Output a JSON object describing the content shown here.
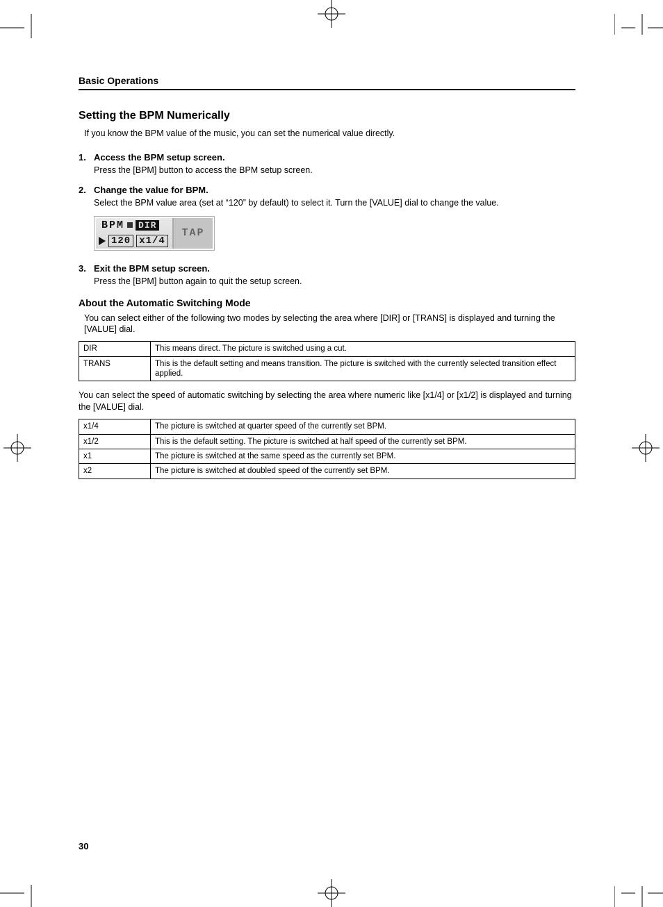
{
  "running_head": "Basic Operations",
  "section_title": "Setting the BPM Numerically",
  "intro": "If you know the BPM value of the music, you can set the numerical value directly.",
  "steps": [
    {
      "title": "Access the BPM setup screen.",
      "body": "Press the [BPM] button to access the BPM setup screen."
    },
    {
      "title": "Change the value for BPM.",
      "body": "Select the BPM value area (set at “120” by default) to select it. Turn the [VALUE] dial to change the value."
    },
    {
      "title": "Exit the BPM setup screen.",
      "body": "Press the [BPM] button again to quit the setup screen."
    }
  ],
  "lcd": {
    "bpm_label": "BPM",
    "mode": "DIR",
    "value": "120",
    "rate": "x1/4",
    "tap": "TAP"
  },
  "subsection_title": "About the Automatic Switching Mode",
  "mode_intro": "You can select either of the following two modes by selecting the area where [DIR] or [TRANS] is displayed and turning the [VALUE] dial.",
  "mode_table": [
    {
      "key": "DIR",
      "desc": "This means direct. The picture is switched using a cut."
    },
    {
      "key": "TRANS",
      "desc": "This is the default setting and means transition. The picture is switched with the currently selected transition effect applied."
    }
  ],
  "speed_intro": "You can select the speed of automatic switching by selecting the area where numeric like [x1/4] or [x1/2] is displayed and turning the [VALUE] dial.",
  "speed_table": [
    {
      "key": "x1/4",
      "desc": "The picture is switched at quarter speed of the currently set BPM."
    },
    {
      "key": "x1/2",
      "desc": "This is the default setting. The picture is switched at half speed of the currently set BPM."
    },
    {
      "key": "x1",
      "desc": "The picture is switched at the same speed as the currently set BPM."
    },
    {
      "key": "x2",
      "desc": "The picture is switched at doubled speed of the currently set BPM."
    }
  ],
  "page_number": "30"
}
